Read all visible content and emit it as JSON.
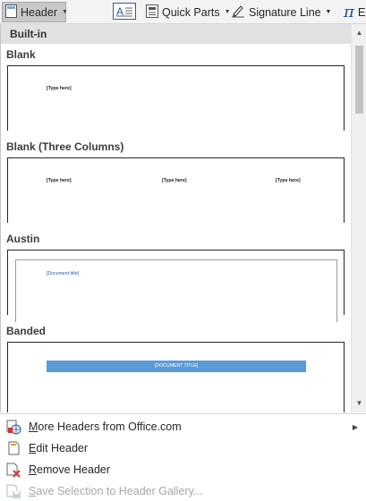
{
  "ribbon": {
    "header_label": "Header",
    "quick_parts_label": "Quick Parts",
    "signature_line_label": "Signature Line",
    "equation_label": "E"
  },
  "gallery": {
    "section_title": "Built-in",
    "items": [
      {
        "label": "Blank",
        "placeholder": "[Type here]"
      },
      {
        "label": "Blank (Three Columns)",
        "placeholders": [
          "[Type here]",
          "[Type here]",
          "[Type here]"
        ]
      },
      {
        "label": "Austin",
        "placeholder": "[Document title]"
      },
      {
        "label": "Banded",
        "placeholder": "[DOCUMENT TITLE]"
      }
    ]
  },
  "menu": {
    "items": [
      {
        "prefix": "",
        "mnemonic": "M",
        "rest": "ore Headers from Office.com",
        "has_submenu": true,
        "disabled": false,
        "icon": "office-globe-icon"
      },
      {
        "prefix": "",
        "mnemonic": "E",
        "rest": "dit Header",
        "has_submenu": false,
        "disabled": false,
        "icon": "edit-header-icon"
      },
      {
        "prefix": "",
        "mnemonic": "R",
        "rest": "emove Header",
        "has_submenu": false,
        "disabled": false,
        "icon": "remove-header-icon"
      },
      {
        "prefix": "",
        "mnemonic": "S",
        "rest": "ave Selection to Header Gallery...",
        "has_submenu": false,
        "disabled": true,
        "icon": "save-selection-icon"
      }
    ]
  },
  "colors": {
    "accent_blue": "#5b9bd5",
    "austin_text": "#2e5a9e",
    "remove_red": "#d13438"
  }
}
